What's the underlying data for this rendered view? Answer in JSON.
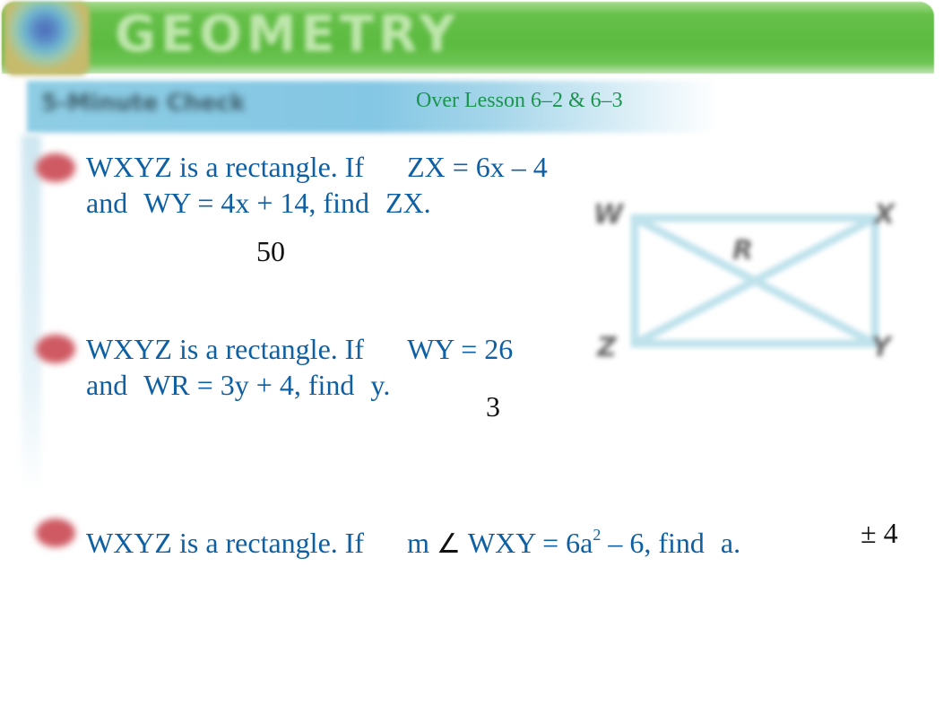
{
  "header": {
    "title": "GEOMETRY",
    "brand_color": "#5cbb40"
  },
  "section": {
    "label": "5-Minute Check",
    "subtitle": "Over Lesson 6–2 & 6–3"
  },
  "diagram": {
    "vertices": [
      "W",
      "X",
      "R",
      "Z",
      "Y"
    ]
  },
  "questions": [
    {
      "line1_a": "WXYZ is a rectangle. If",
      "line1_b": "ZX = 6x – 4",
      "line2_a": "and",
      "line2_b": "WY = 4x + 14, find",
      "line2_c": "ZX.",
      "answer": "50"
    },
    {
      "line1_a": "WXYZ is a rectangle. If",
      "line1_b": "WY = 26",
      "line2_a": "and",
      "line2_b": "WR = 3y + 4, find",
      "line2_c": "y.",
      "answer": "3"
    },
    {
      "line1_a": "WXYZ is a rectangle. If",
      "m": "m",
      "angle_symbol": "∠",
      "expr_a": "WXY = 6a",
      "exponent": "2",
      "expr_b": "– 6, find",
      "find_var": "a.",
      "answer": "± 4"
    }
  ]
}
